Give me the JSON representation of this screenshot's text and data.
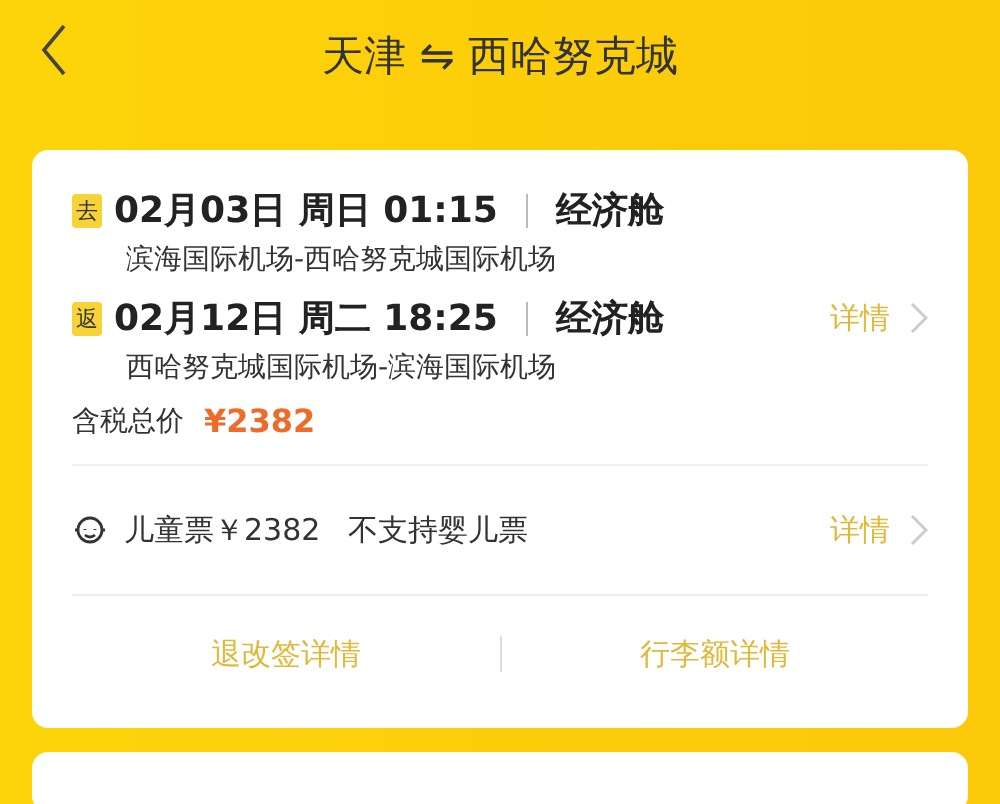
{
  "header": {
    "origin": "天津",
    "swap_icon": "⇋",
    "destination": "西哈努克城"
  },
  "legs": [
    {
      "tag": "去",
      "datetime": "02月03日 周日 01:15",
      "cabin": "经济舱",
      "route": "滨海国际机场-西哈努克城国际机场"
    },
    {
      "tag": "返",
      "datetime": "02月12日 周二 18:25",
      "cabin": "经济舱",
      "route": "西哈努克城国际机场-滨海国际机场",
      "detail": "详情"
    }
  ],
  "price": {
    "label": "含税总价",
    "amount": "¥2382"
  },
  "child": {
    "text": "儿童票￥2382",
    "note": "不支持婴儿票",
    "detail": "详情"
  },
  "links": [
    "退改签详情",
    "行李额详情"
  ]
}
